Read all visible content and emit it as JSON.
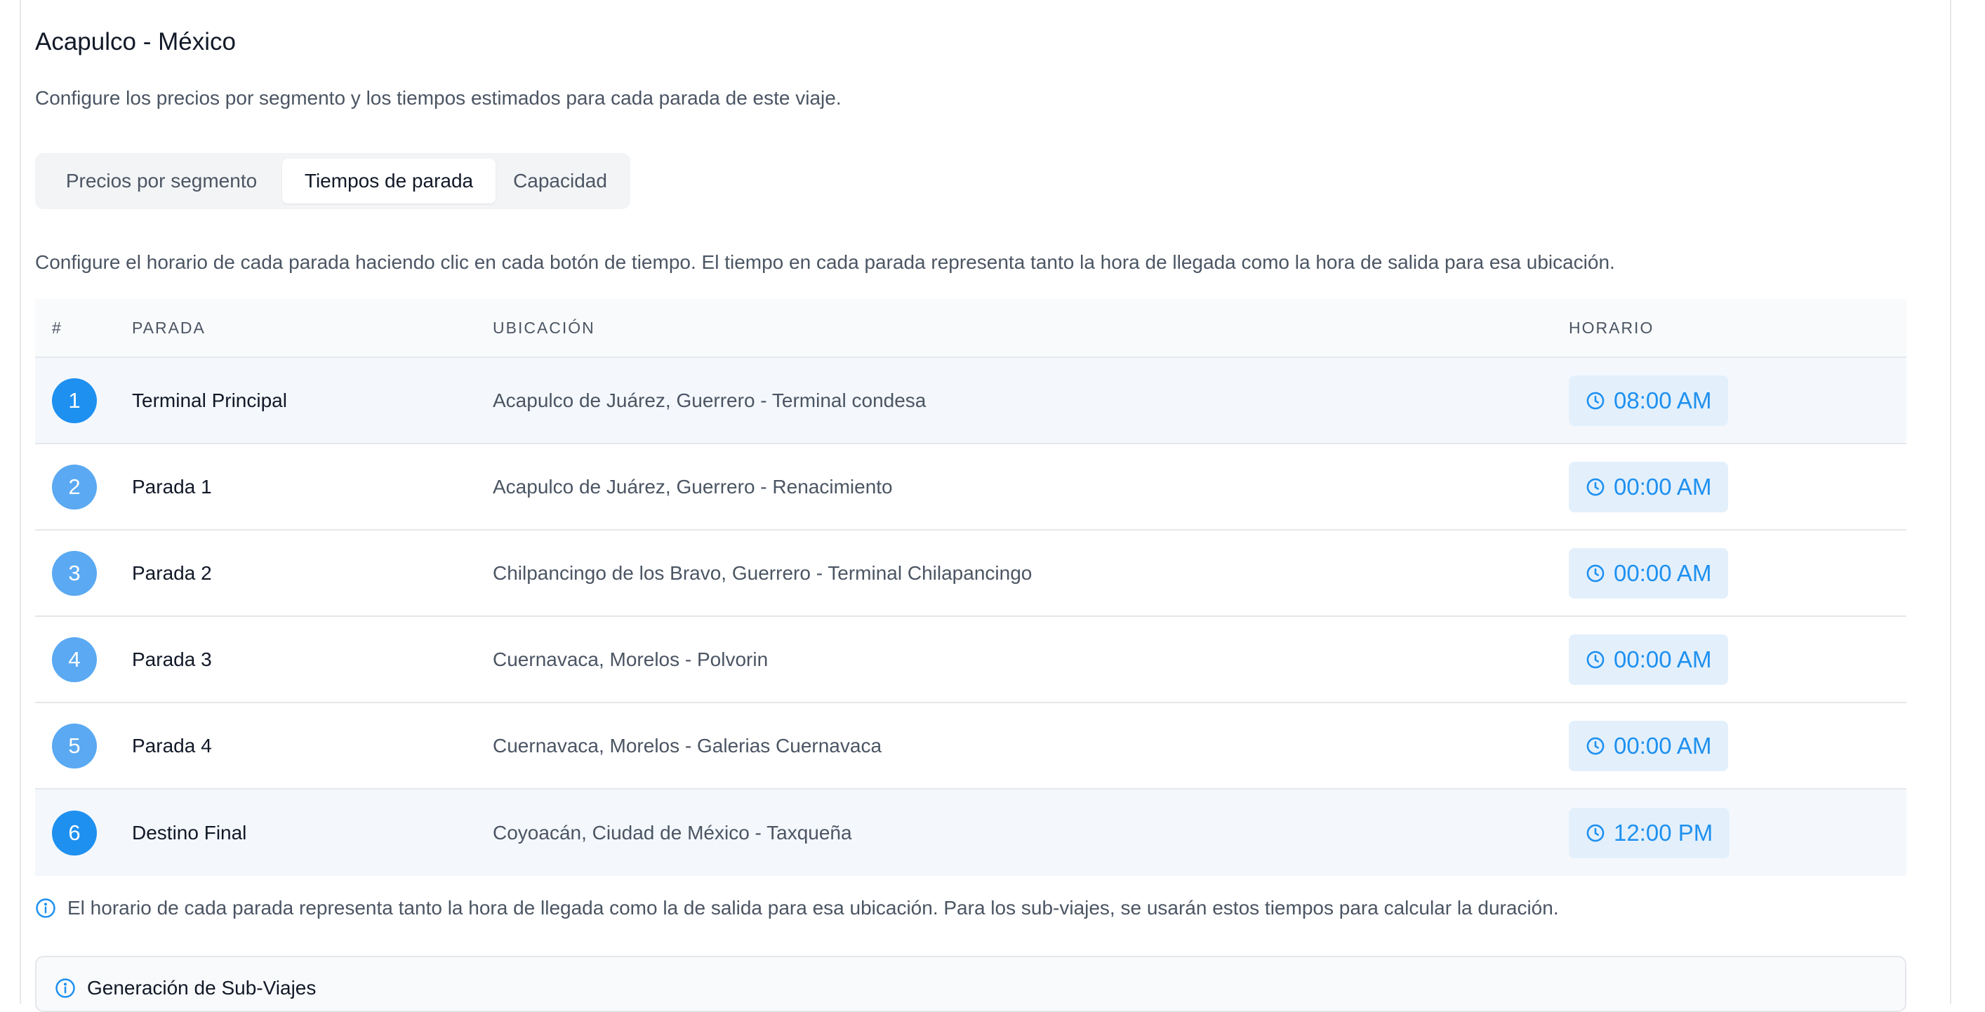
{
  "header": {
    "title": "Acapulco - México",
    "subtitle": "Configure los precios por segmento y los tiempos estimados para cada parada de este viaje."
  },
  "tabs": [
    {
      "label": "Precios por segmento",
      "active": false
    },
    {
      "label": "Tiempos de parada",
      "active": true
    },
    {
      "label": "Capacidad",
      "active": false
    }
  ],
  "help_text": "Configure el horario de cada parada haciendo clic en cada botón de tiempo. El tiempo en cada parada representa tanto la hora de llegada como la hora de salida para esa ubicación.",
  "table": {
    "headers": {
      "num": "#",
      "stop": "PARADA",
      "location": "UBICACIÓN",
      "schedule": "HORARIO"
    },
    "rows": [
      {
        "num": "1",
        "stop": "Terminal Principal",
        "location": "Acapulco de Juárez, Guerrero - Terminal condesa",
        "time": "08:00 AM"
      },
      {
        "num": "2",
        "stop": "Parada 1",
        "location": "Acapulco de Juárez, Guerrero - Renacimiento",
        "time": "00:00 AM"
      },
      {
        "num": "3",
        "stop": "Parada 2",
        "location": "Chilpancingo de los Bravo, Guerrero - Terminal Chilapancingo",
        "time": "00:00 AM"
      },
      {
        "num": "4",
        "stop": "Parada 3",
        "location": "Cuernavaca, Morelos - Polvorin",
        "time": "00:00 AM"
      },
      {
        "num": "5",
        "stop": "Parada 4",
        "location": "Cuernavaca, Morelos - Galerias Cuernavaca",
        "time": "00:00 AM"
      },
      {
        "num": "6",
        "stop": "Destino Final",
        "location": "Coyoacán, Ciudad de México - Taxqueña",
        "time": "12:00 PM"
      }
    ]
  },
  "info_note": "El horario de cada parada representa tanto la hora de llegada como la de salida para esa ubicación. Para los sub-viajes, se usarán estos tiempos para calcular la duración.",
  "sub_trips": {
    "title": "Generación de Sub-Viajes"
  },
  "colors": {
    "accent": "#1e90f0",
    "accent_light": "#5aa9f2",
    "time_bg": "#e3f0fc"
  },
  "icons": {
    "time": "clock-icon",
    "info": "info-icon"
  }
}
